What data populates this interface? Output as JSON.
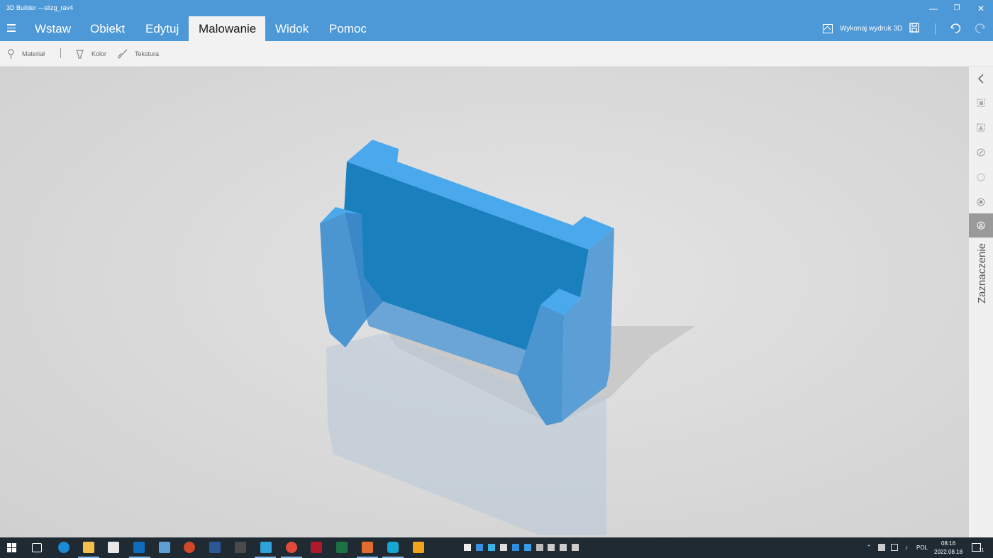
{
  "window": {
    "title": "3D Builder —slizg_rav4",
    "controls": {
      "minimize": "—",
      "restore": "❐",
      "close": "✕"
    }
  },
  "menu": {
    "tabs": [
      {
        "label": "Wstaw"
      },
      {
        "label": "Obiekt"
      },
      {
        "label": "Edytuj"
      },
      {
        "label": "Malowanie",
        "active": true
      },
      {
        "label": "Widok"
      },
      {
        "label": "Pomoc"
      }
    ],
    "print_label": "Wykonaj wydruk 3D"
  },
  "toolbar": {
    "material_label": "Materiał",
    "color_label": "Kolor",
    "texture_label": "Tekstura"
  },
  "side_panel": {
    "label": "Zaznaczenie",
    "icons": [
      "collapse-chevron-icon",
      "select-objects-icon",
      "select-faces-icon",
      "paint-bucket-icon",
      "circle-icon",
      "fill-icon",
      "selection-icon"
    ]
  },
  "model": {
    "color_top": "#4aa8ec",
    "color_front": "#1a7fbd",
    "color_side": "#5b9fd6"
  },
  "taskbar": {
    "language": "POL",
    "time": "08:16",
    "date": "2022.08.18",
    "notification_count": "11"
  },
  "colors": {
    "accent": "#4d98d6",
    "taskbar": "#1f2a33"
  }
}
